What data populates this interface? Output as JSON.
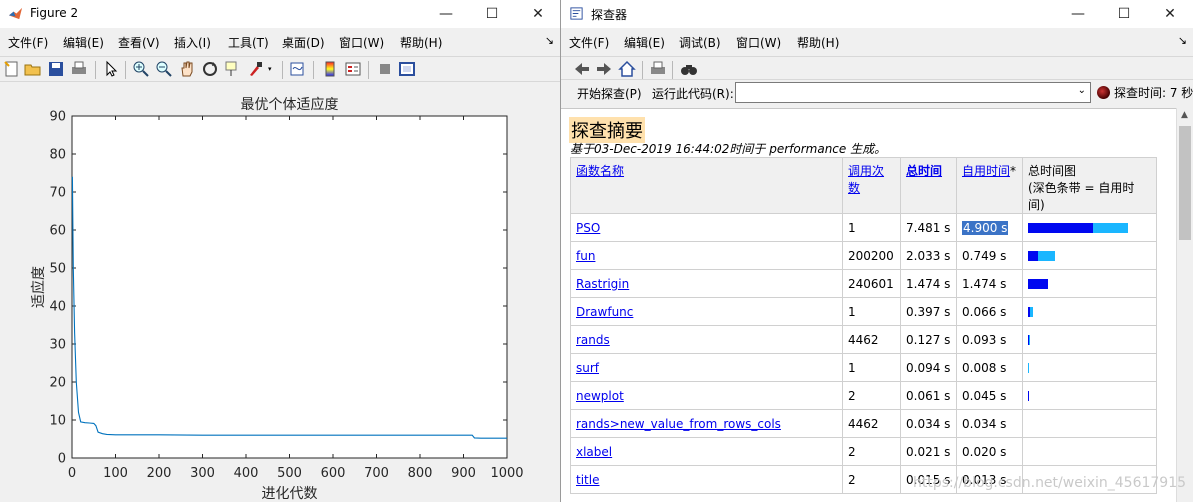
{
  "figure": {
    "title": "Figure 2",
    "menus": [
      "文件(F)",
      "编辑(E)",
      "查看(V)",
      "插入(I)",
      "工具(T)",
      "桌面(D)",
      "窗口(W)",
      "帮助(H)"
    ],
    "dock_glyph": "↘"
  },
  "chart_data": {
    "type": "line",
    "title": "最优个体适应度",
    "xlabel": "进化代数",
    "ylabel": "适应度",
    "xlim": [
      0,
      1000
    ],
    "ylim": [
      0,
      90
    ],
    "xticks": [
      0,
      100,
      200,
      300,
      400,
      500,
      600,
      700,
      800,
      900,
      1000
    ],
    "yticks": [
      0,
      10,
      20,
      30,
      40,
      50,
      60,
      70,
      80,
      90
    ],
    "grid": false,
    "line_color": "#0072bd",
    "series": [
      {
        "x": [
          1,
          3,
          6,
          10,
          15,
          20,
          30,
          40,
          50,
          55,
          60,
          70,
          80,
          100,
          150,
          200,
          300,
          500,
          700,
          900,
          920,
          925,
          940,
          960,
          1000
        ],
        "values": [
          74,
          50,
          33,
          20,
          12,
          9.5,
          9.3,
          9.2,
          9.1,
          8.5,
          6.8,
          6.4,
          6.2,
          6.1,
          6.1,
          6.1,
          6.0,
          6.0,
          6.0,
          6.0,
          6.0,
          5.3,
          5.2,
          5.2,
          5.2
        ]
      }
    ]
  },
  "profiler": {
    "title": "探查器",
    "menus": [
      "文件(F)",
      "编辑(E)",
      "调试(B)",
      "窗口(W)",
      "帮助(H)"
    ],
    "dock_glyph": "↘",
    "start_label": "开始探查(P)",
    "run_label": "运行此代码(R):",
    "run_value": "",
    "status": "探查时间: 7 秒",
    "heading": "探查摘要",
    "subtitle": "基于03-Dec-2019 16:44:02时间于 performance 生成。",
    "headers": {
      "name": "函数名称",
      "calls": "调用次数",
      "total": "总时间",
      "self": "自用时间",
      "self_mark": "*",
      "graph_line1": "总时间图",
      "graph_line2": "(深色条带 = 自用时间)"
    },
    "rows": [
      {
        "name": "PSO",
        "calls": "1",
        "total": "7.481 s",
        "self": "4.900 s",
        "total_frac": 0.74,
        "self_frac": 0.485,
        "highlight": true
      },
      {
        "name": "fun",
        "calls": "200200",
        "total": "2.033 s",
        "self": "0.749 s",
        "total_frac": 0.201,
        "self_frac": 0.074
      },
      {
        "name": "Rastrigin",
        "calls": "240601",
        "total": "1.474 s",
        "self": "1.474 s",
        "total_frac": 0.146,
        "self_frac": 0.146
      },
      {
        "name": "Drawfunc",
        "calls": "1",
        "total": "0.397 s",
        "self": "0.066 s",
        "total_frac": 0.039,
        "self_frac": 0.015
      },
      {
        "name": "rands",
        "calls": "4462",
        "total": "0.127 s",
        "self": "0.093 s",
        "total_frac": 0.013,
        "self_frac": 0.009
      },
      {
        "name": "surf",
        "calls": "1",
        "total": "0.094 s",
        "self": "0.008 s",
        "total_frac": 0.009,
        "self_frac": 0.0
      },
      {
        "name": "newplot",
        "calls": "2",
        "total": "0.061 s",
        "self": "0.045 s",
        "total_frac": 0.008,
        "self_frac": 0.006
      },
      {
        "name": "rands>new_value_from_rows_cols",
        "calls": "4462",
        "total": "0.034 s",
        "self": "0.034 s",
        "total_frac": 0.0,
        "self_frac": 0.0
      },
      {
        "name": "xlabel",
        "calls": "2",
        "total": "0.021 s",
        "self": "0.020 s",
        "total_frac": 0.0,
        "self_frac": 0.0
      },
      {
        "name": "title",
        "calls": "2",
        "total": "0.015 s",
        "self": "0.013 s",
        "total_frac": 0.0,
        "self_frac": 0.0
      }
    ]
  },
  "watermark": "https://blog.csdn.net/weixin_45617915",
  "window_controls": {
    "minimize": "—",
    "maximize": "☐",
    "close": "✕"
  }
}
